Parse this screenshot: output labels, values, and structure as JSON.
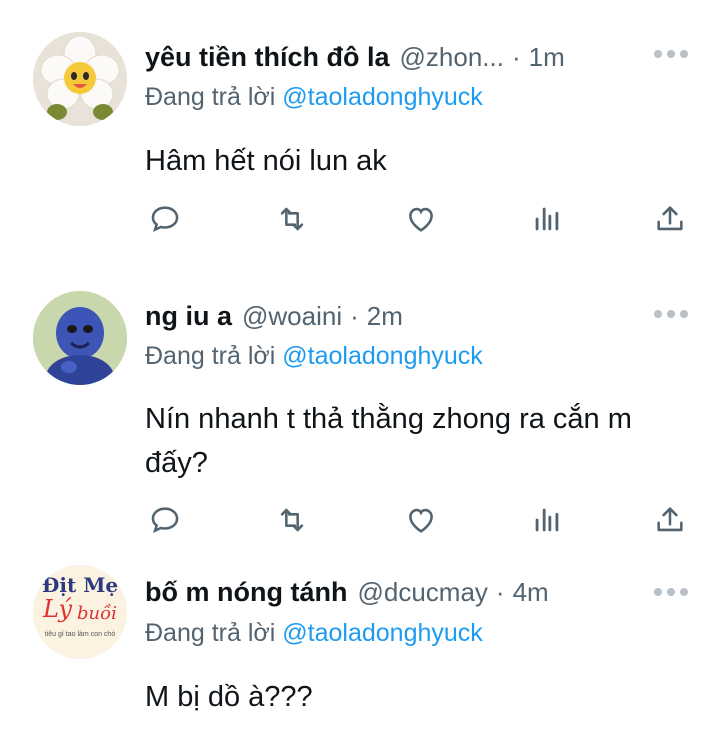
{
  "tweets": [
    {
      "name": "yêu tiền thích đô la",
      "handle": "@zhon...",
      "dot": "·",
      "time": "1m",
      "reply_prefix": "Đang trả lời ",
      "reply_to": "@taoladonghyuck",
      "text": "Hâm hết nói lun ak",
      "avatar_icon": "flower-plush-avatar"
    },
    {
      "name": "ng iu a",
      "handle": "@woaini",
      "dot": "·",
      "time": "2m",
      "reply_prefix": "Đang trả lời ",
      "reply_to": "@taoladonghyuck",
      "text": "Nín nhanh t thả thằng zhong ra cắn m đấy?",
      "avatar_icon": "blue-figure-avatar"
    },
    {
      "name": "bố m nóng tánh",
      "handle": "@dcucmay",
      "dot": "·",
      "time": "4m",
      "reply_prefix": "Đang trả lời ",
      "reply_to": "@taoladonghyuck",
      "text": "M bị dồ à???",
      "avatar_icon": "text-sticker-avatar",
      "avatar_text_line1": "Địt Mẹ",
      "avatar_text_line2": "Lý",
      "avatar_text_line3": "buồi",
      "avatar_text_small": "tiêu gì tao làm con chó"
    }
  ],
  "colors": {
    "text": "#0f1419",
    "secondary": "#536471",
    "mention": "#1d9bf0",
    "icon": "#536471"
  },
  "action_icons": [
    "reply-icon",
    "retweet-icon",
    "like-icon",
    "views-icon",
    "share-icon"
  ]
}
